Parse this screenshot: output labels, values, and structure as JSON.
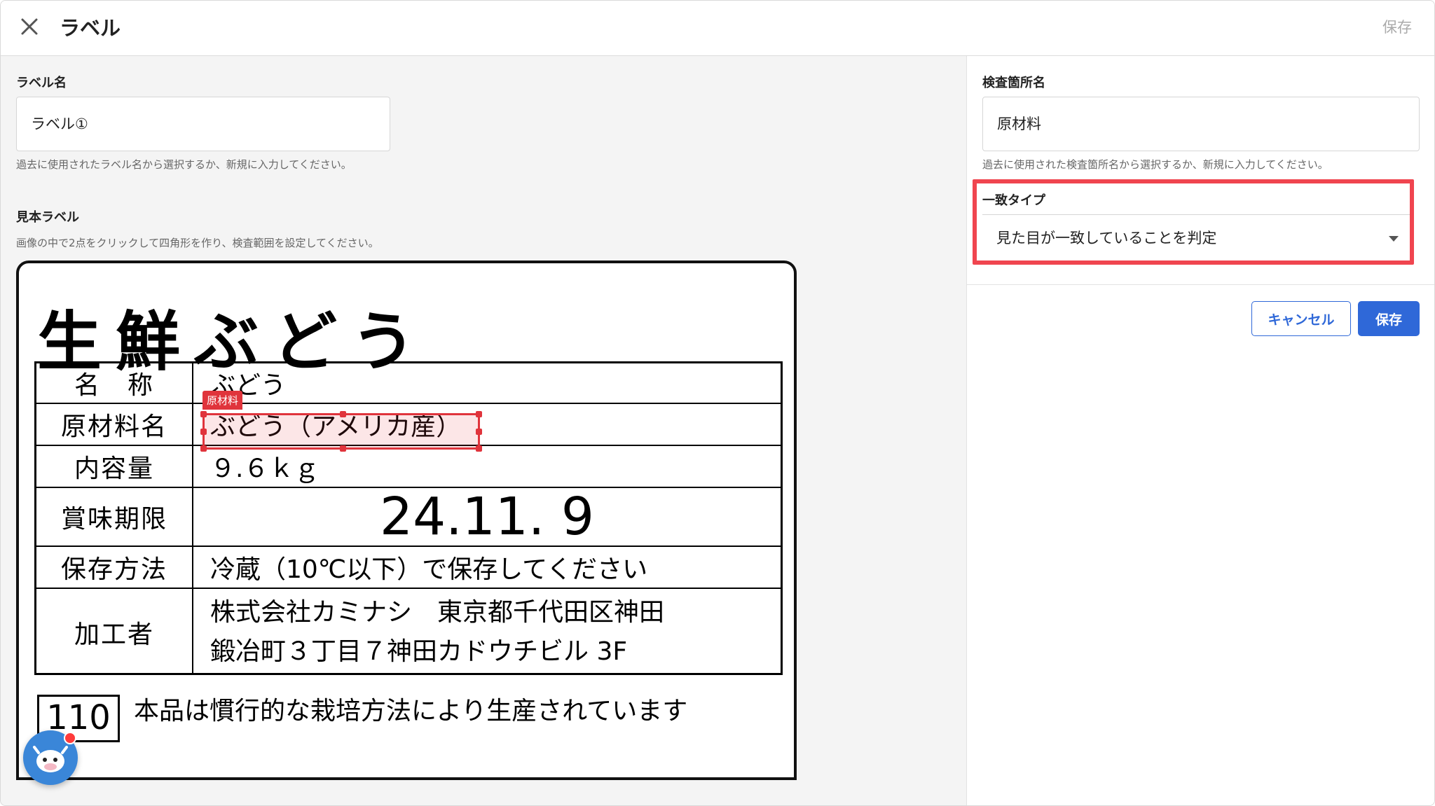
{
  "header": {
    "title": "ラベル",
    "save_label": "保存"
  },
  "left": {
    "label_name": {
      "label": "ラベル名",
      "value": "ラベル①",
      "help": "過去に使用されたラベル名から選択するか、新規に入力してください。"
    },
    "sample": {
      "label": "見本ラベル",
      "help": "画像の中で2点をクリックして四角形を作り、検査範囲を設定してください。",
      "image": {
        "title": "生鮮ぶどう",
        "rows": [
          {
            "head": "名　称",
            "value": "ぶどう"
          },
          {
            "head": "原材料名",
            "value": "ぶどう（アメリカ産）"
          },
          {
            "head": "内容量",
            "value": "９.６ｋｇ"
          },
          {
            "head": "賞味期限",
            "value": "24.11. 9"
          },
          {
            "head": "保存方法",
            "value": "冷蔵（10℃以下）で保存してください"
          },
          {
            "head": "加工者",
            "value_line1": "株式会社カミナシ　東京都千代田区神田",
            "value_line2": "鍛冶町３丁目７神田カドウチビル 3F"
          }
        ],
        "code": "110",
        "footer": "本品は慣行的な栽培方法により生産されています"
      },
      "selection_tag": "原材料"
    }
  },
  "right": {
    "inspection_name": {
      "label": "検査箇所名",
      "value": "原材料",
      "help": "過去に使用された検査箇所名から選択するか、新規に入力してください。"
    },
    "match_type": {
      "label": "一致タイプ",
      "value": "見た目が一致していることを判定"
    },
    "cancel_label": "キャンセル",
    "save_label": "保存"
  },
  "colors": {
    "primary": "#2f68d8",
    "highlight": "#f0454f",
    "selection": "#e0343c"
  }
}
